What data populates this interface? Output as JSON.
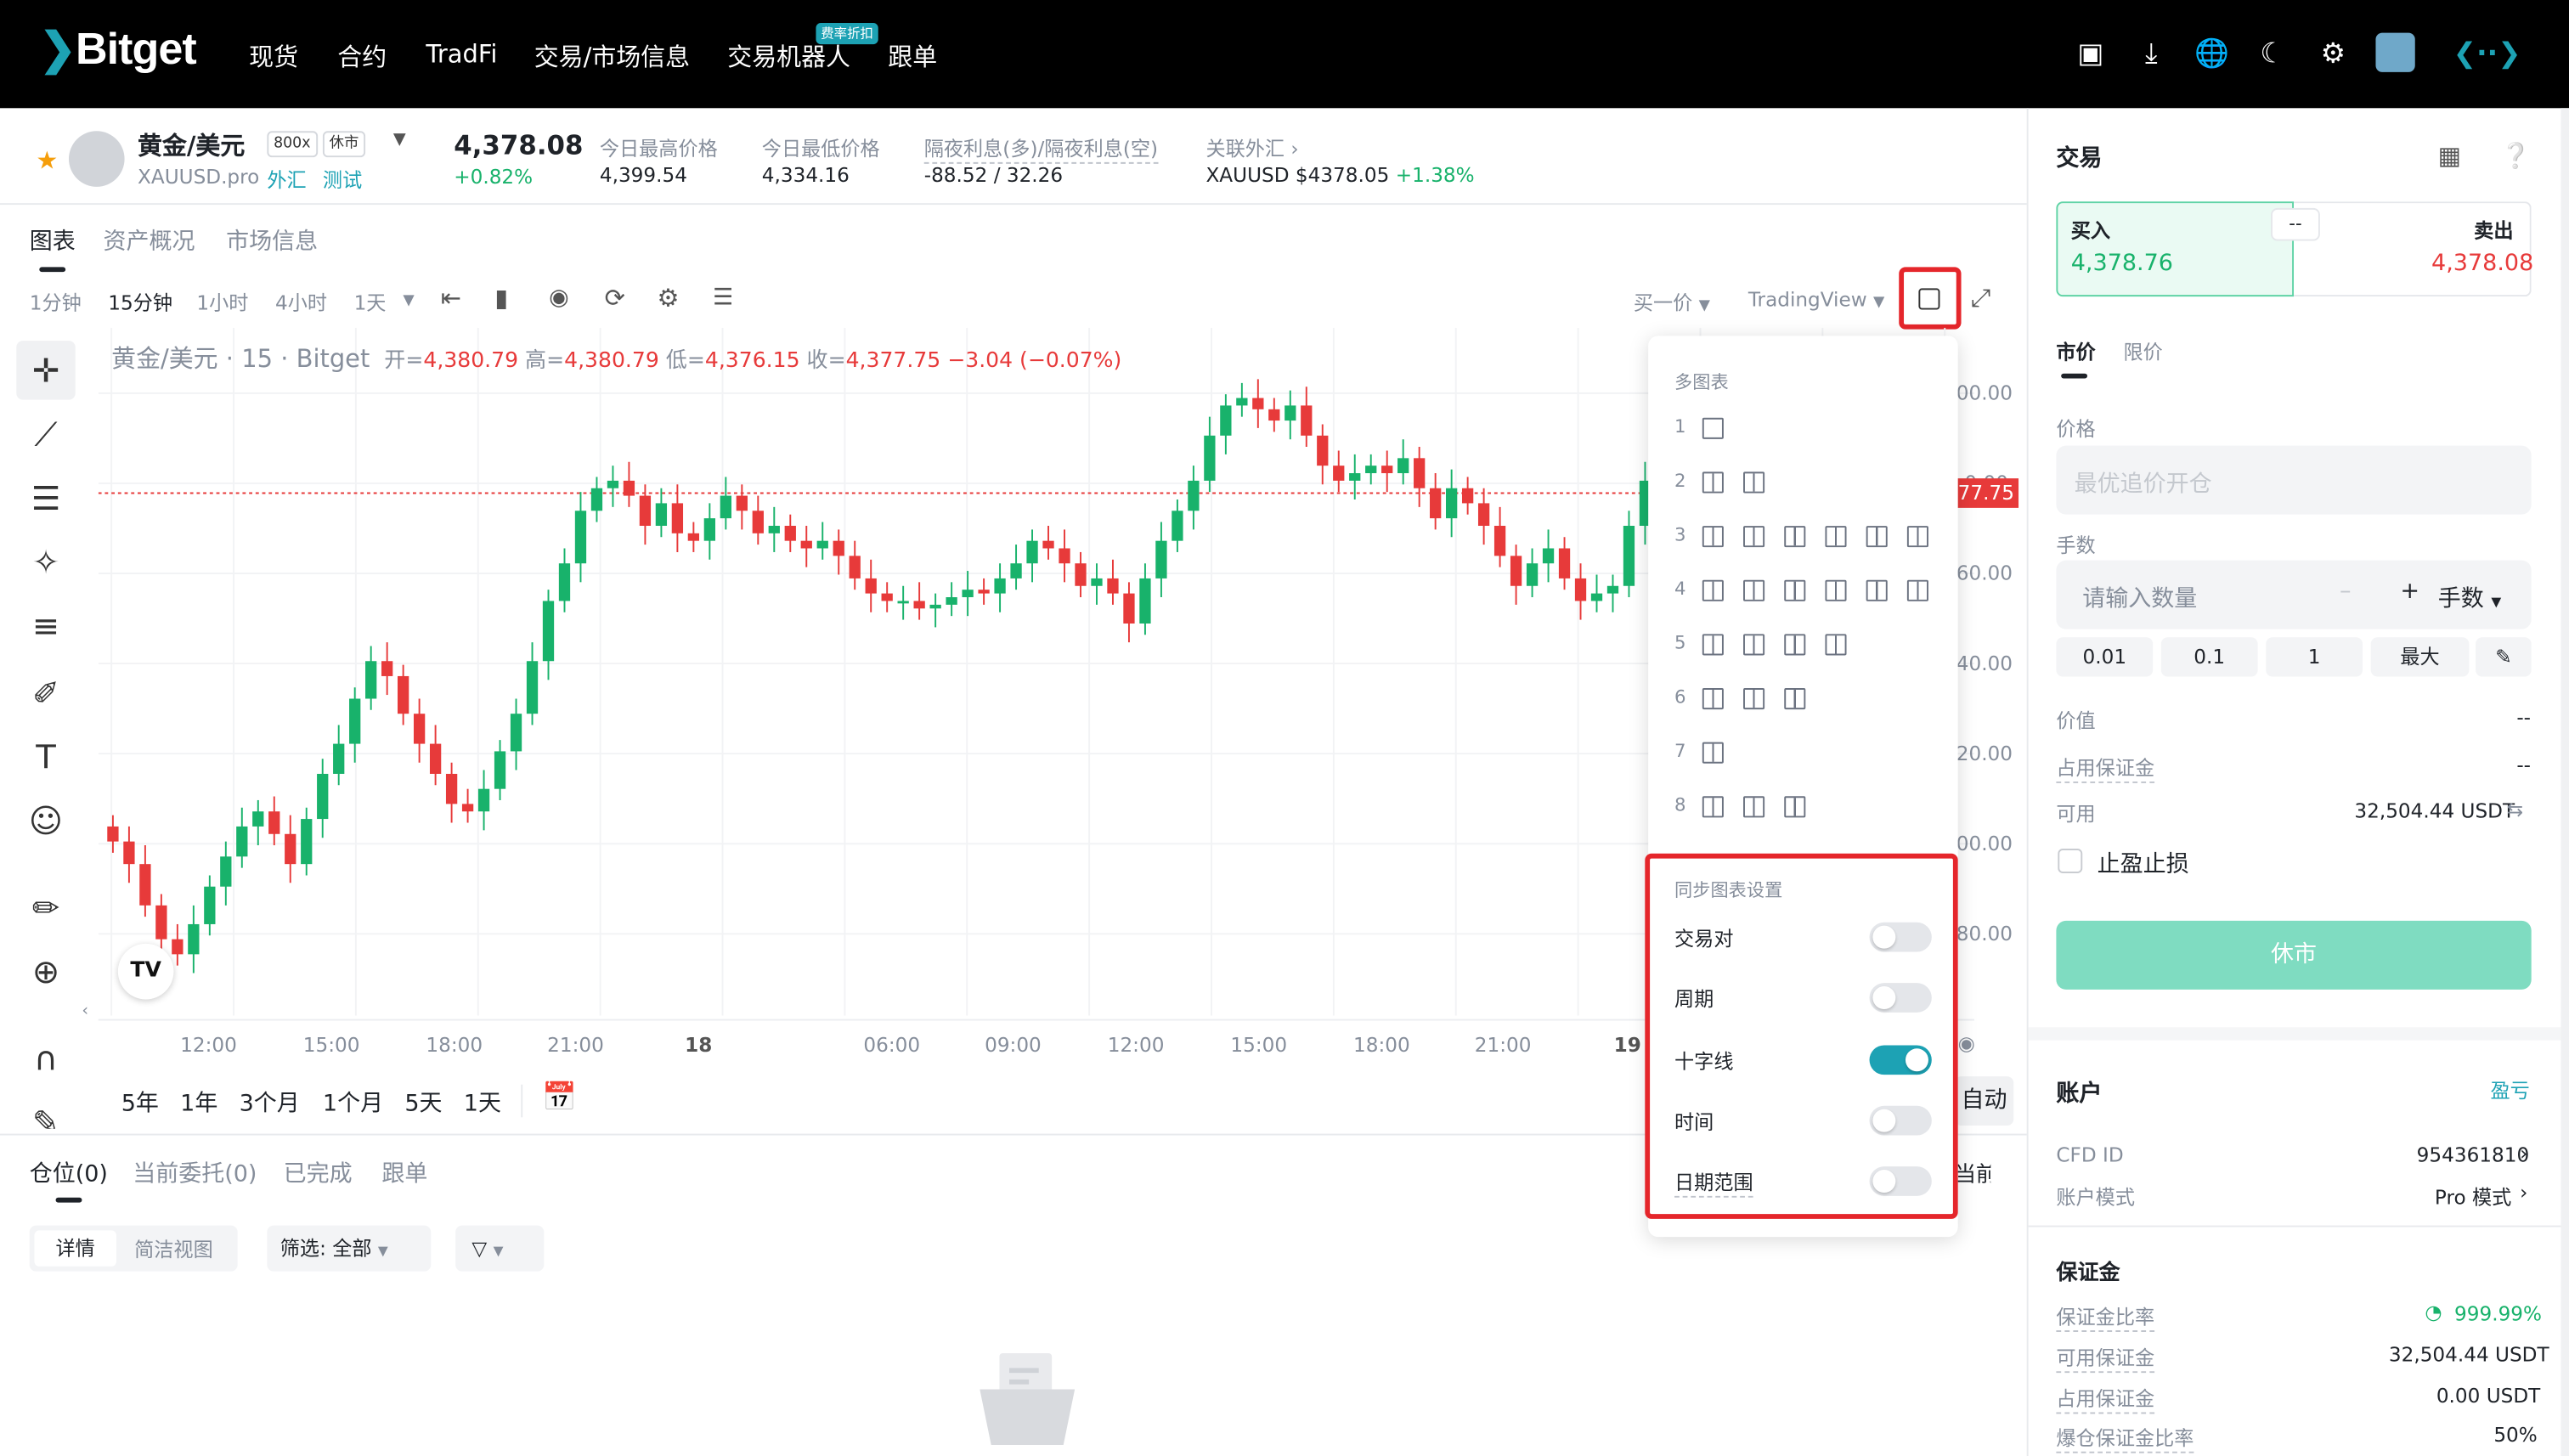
{
  "nav": {
    "logo": "Bitget",
    "items": [
      "现货",
      "合约",
      "TradFi",
      "交易/市场信息",
      "交易机器人",
      "跟单"
    ],
    "bot_badge": "费率折扣"
  },
  "symbol": {
    "name": "黄金/美元",
    "leverage": "800x",
    "status_tag": "休市",
    "ticker": "XAUUSD.pro",
    "category": "外汇",
    "test_label": "测试",
    "price": "4,378.08",
    "change": "+0.82%",
    "stats": [
      {
        "label": "今日最高价格",
        "value": "4,399.54"
      },
      {
        "label": "今日最低价格",
        "value": "4,334.16"
      },
      {
        "label": "隔夜利息(多)/隔夜利息(空)",
        "value": "-88.52 / 32.26"
      }
    ],
    "related_label": "关联外汇",
    "related_value": "XAUUSD $4378.05",
    "related_change": "+1.38%"
  },
  "chart_tabs": [
    "图表",
    "资产概况",
    "市场信息"
  ],
  "timeframes": [
    "1分钟",
    "15分钟",
    "1小时",
    "4小时",
    "1天"
  ],
  "chart_toolbar": {
    "buy_one": "买一价",
    "tradingview": "TradingView"
  },
  "chart_legend": {
    "title": "黄金/美元 · 15 · Bitget",
    "o_label": "开=",
    "o": "4,380.79",
    "h_label": "高=",
    "h": "4,380.79",
    "l_label": "低=",
    "l": "4,376.15",
    "c_label": "收=",
    "c": "4,377.75",
    "chg": "−3.04 (−0.07%)"
  },
  "current_price_tag": "77.75",
  "x_ticks": [
    "12:00",
    "15:00",
    "18:00",
    "21:00",
    "18",
    "06:00",
    "09:00",
    "12:00",
    "15:00",
    "18:00",
    "21:00",
    "19"
  ],
  "y_ticks": [
    "00.00",
    "60.00",
    "40.00",
    "20.00",
    "00.00",
    "80.00"
  ],
  "y_tick_partial": "0.00",
  "tv_logo": "TV",
  "ranges": [
    "5年",
    "1年",
    "3个月",
    "1个月",
    "5天",
    "1天"
  ],
  "auto_label": "自动",
  "bottom": {
    "tabs": [
      "仓位(0)",
      "当前委托(0)",
      "已完成",
      "跟单"
    ],
    "view_detail": "详情",
    "view_simple": "简洁视图",
    "filter": "筛选: 全部",
    "right_partial": "当前"
  },
  "dropdown": {
    "multi_title": "多图表",
    "rows": [
      {
        "n": "1",
        "count": 1
      },
      {
        "n": "2",
        "count": 2
      },
      {
        "n": "3",
        "count": 6
      },
      {
        "n": "4",
        "count": 6
      },
      {
        "n": "5",
        "count": 4
      },
      {
        "n": "6",
        "count": 3
      },
      {
        "n": "7",
        "count": 1
      },
      {
        "n": "8",
        "count": 3
      }
    ],
    "sync_title": "同步图表设置",
    "toggles": [
      {
        "label": "交易对",
        "on": false
      },
      {
        "label": "周期",
        "on": false
      },
      {
        "label": "十字线",
        "on": true
      },
      {
        "label": "时间",
        "on": false
      },
      {
        "label": "日期范围",
        "on": false
      }
    ]
  },
  "trade": {
    "title": "交易",
    "buy_label": "买入",
    "buy_price": "4,378.76",
    "sell_label": "卖出",
    "sell_price": "4,378.08",
    "spread": "--",
    "order_types": [
      "市价",
      "限价"
    ],
    "price_label": "价格",
    "price_placeholder": "最优追价开仓",
    "qty_label": "手数",
    "qty_placeholder": "请输入数量",
    "qty_unit": "手数",
    "qty_presets": [
      "0.01",
      "0.1",
      "1",
      "最大"
    ],
    "value_label": "价值",
    "value_val": "--",
    "margin_used_label": "占用保证金",
    "margin_used_val": "--",
    "available_label": "可用",
    "available_val": "32,504.44 USDT",
    "tpsl_label": "止盈止损",
    "submit": "休市"
  },
  "account": {
    "title": "账户",
    "pnl_link": "盈亏",
    "cfd_label": "CFD ID",
    "cfd_val": "954361810",
    "mode_label": "账户模式",
    "mode_val": "Pro 模式",
    "margin_title": "保证金",
    "rows": [
      {
        "label": "保证金比率",
        "value": "999.99%"
      },
      {
        "label": "可用保证金",
        "value": "32,504.44 USDT"
      },
      {
        "label": "占用保证金",
        "value": "0.00 USDT"
      },
      {
        "label": "爆仓保证金比率",
        "value": "50%"
      }
    ]
  },
  "colors": {
    "up": "#18b26b",
    "down": "#e73a3a",
    "accent": "#1da2b4",
    "highlight": "#e5262b"
  },
  "chart_data": {
    "type": "candlestick",
    "title": "黄金/美元 · 15 · Bitget",
    "interval": "15分钟",
    "current_price_label": "77.75",
    "x_tick_labels": [
      "12:00",
      "15:00",
      "18:00",
      "21:00",
      "18",
      "06:00",
      "09:00",
      "12:00",
      "15:00",
      "18:00",
      "21:00",
      "19"
    ],
    "y_tick_labels_partial": [
      "00.00",
      "60.00",
      "40.00",
      "20.00",
      "00.00",
      "80.00"
    ],
    "closes": [
      4292,
      4286,
      4275,
      4266,
      4262,
      4270,
      4280,
      4288,
      4296,
      4300,
      4294,
      4286,
      4298,
      4310,
      4318,
      4330,
      4340,
      4336,
      4326,
      4318,
      4310,
      4302,
      4300,
      4306,
      4316,
      4326,
      4340,
      4356,
      4366,
      4380,
      4386,
      4388,
      4384,
      4376,
      4382,
      4374,
      4372,
      4378,
      4384,
      4380,
      4374,
      4376,
      4372,
      4370,
      4372,
      4368,
      4362,
      4358,
      4356,
      4356,
      4354,
      4355,
      4357,
      4359,
      4358,
      4362,
      4366,
      4372,
      4370,
      4366,
      4360,
      4362,
      4358,
      4350,
      4362,
      4372,
      4380,
      4388,
      4400,
      4408,
      4410,
      4407,
      4404,
      4408,
      4400,
      4392,
      4388,
      4390,
      4392,
      4390,
      4394,
      4386,
      4378,
      4386,
      4382,
      4376,
      4368,
      4360,
      4366,
      4370,
      4362,
      4356,
      4358,
      4360,
      4376,
      4388
    ]
  }
}
